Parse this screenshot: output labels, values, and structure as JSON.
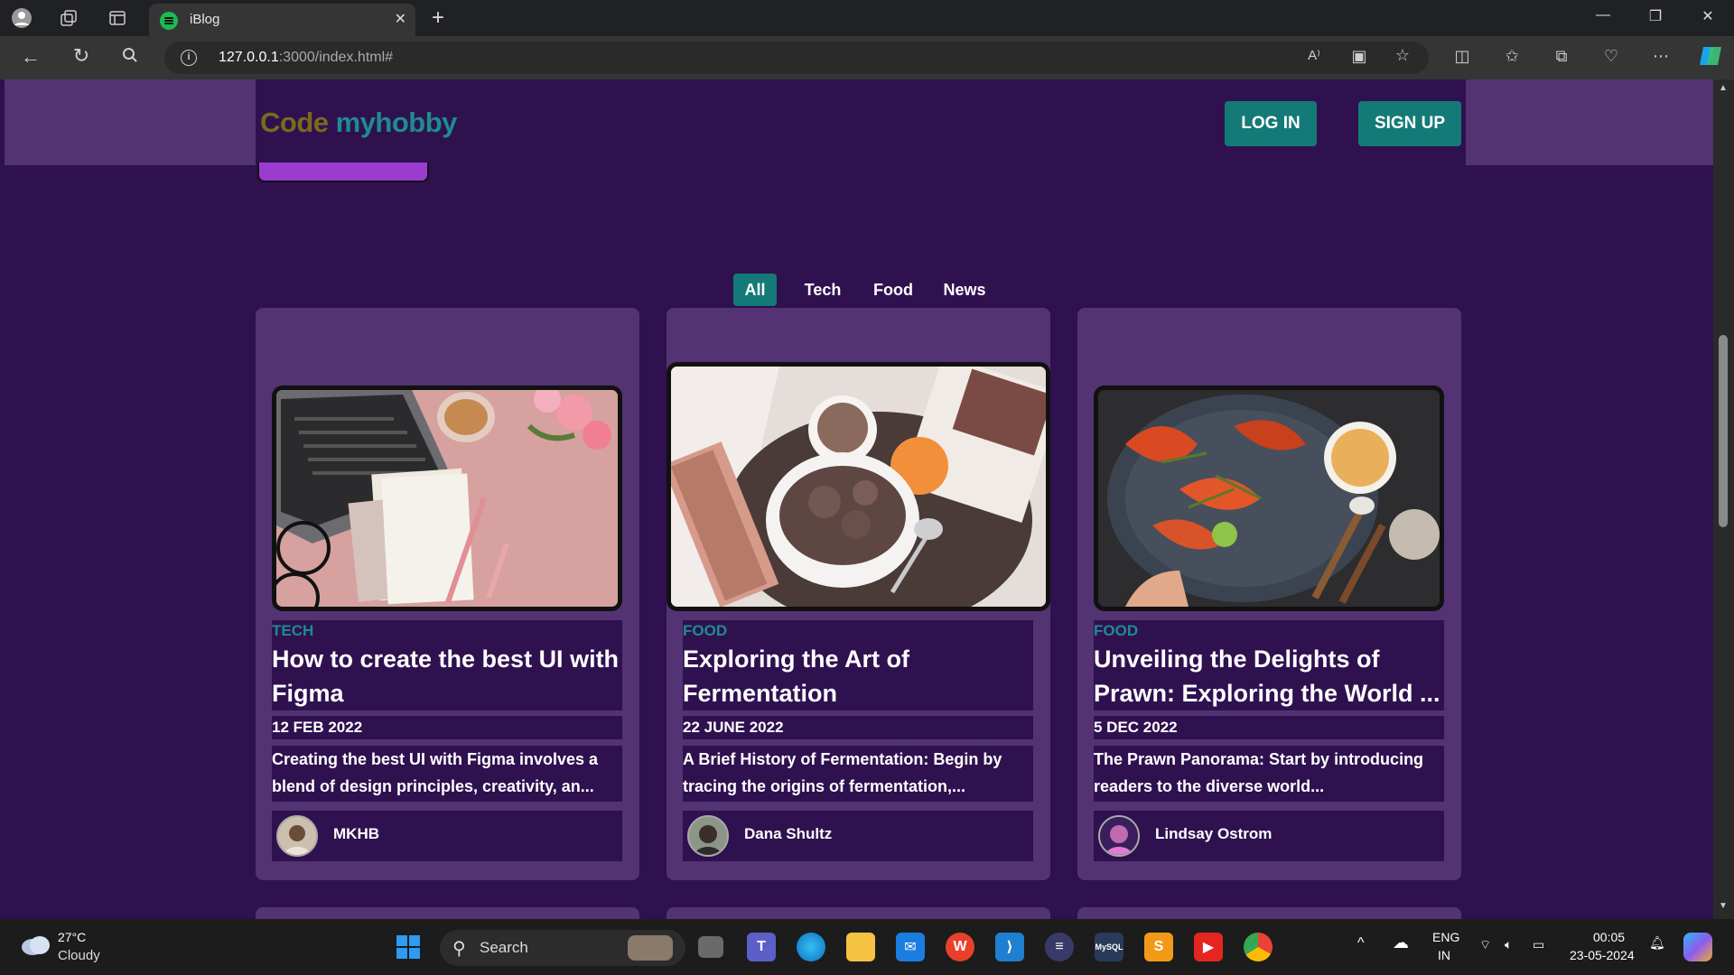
{
  "browser": {
    "tab_title": "iBlog",
    "url_host": "127.0.0.1",
    "url_rest": ":3000/index.html#"
  },
  "site": {
    "logo_part1": "Code",
    "logo_part2": "myhobby",
    "login_label": "LOG IN",
    "signup_label": "SIGN UP"
  },
  "filters": [
    {
      "label": "All",
      "active": true
    },
    {
      "label": "Tech",
      "active": false
    },
    {
      "label": "Food",
      "active": false
    },
    {
      "label": "News",
      "active": false
    }
  ],
  "cards": [
    {
      "category": "TECH",
      "title": "How to create the best UI with Figma",
      "date": "12 FEB 2022",
      "description": "Creating the best UI with Figma involves a blend of design principles, creativity, an...",
      "author": "MKHB"
    },
    {
      "category": "FOOD",
      "title": "Exploring the Art of Fermentation",
      "date": "22 JUNE 2022",
      "description": "A Brief History of Fermentation: Begin by tracing the origins of fermentation,...",
      "author": "Dana Shultz"
    },
    {
      "category": "FOOD",
      "title": "Unveiling the Delights of Prawn: Exploring the World ...",
      "date": "5 DEC 2022",
      "description": "The Prawn Panorama: Start by introducing readers to the diverse world...",
      "author": "Lindsay Ostrom"
    }
  ],
  "taskbar": {
    "weather_temp": "27°C",
    "weather_desc": "Cloudy",
    "search_label": "Search",
    "lang_top": "ENG",
    "lang_bottom": "IN",
    "time": "00:05",
    "date": "23-05-2024"
  },
  "colors": {
    "page_bg": "#2f1150",
    "card_bg": "#533373",
    "accent_teal": "#147a77",
    "logo_gold": "#7c6a1b"
  }
}
